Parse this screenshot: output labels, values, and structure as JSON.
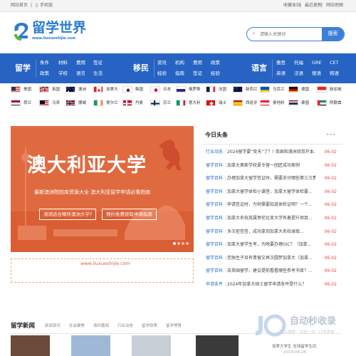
{
  "topbar": {
    "home": "网站首页",
    "mobile": "手机版",
    "favorite": "收藏本站",
    "latest": "最近更新",
    "sitemap": "网站地图"
  },
  "logo": {
    "text": "留学世界",
    "url": "www.liuxueshijie.com"
  },
  "search": {
    "placeholder": "请输入关键词",
    "button": "搜索"
  },
  "nav": {
    "study": {
      "title": "留学",
      "links": [
        "条件",
        "材料",
        "费用",
        "签证",
        "政策",
        "学校",
        "语言",
        "生活"
      ]
    },
    "immigrate": {
      "title": "移民",
      "links": [
        "资讯",
        "机构",
        "费用",
        "政策",
        "经验",
        "指南",
        "签证",
        "经验"
      ]
    },
    "language": {
      "title": "语言",
      "links": [
        "雅思",
        "托福",
        "GRE",
        "CET",
        "英语",
        "法语",
        "德语",
        "韩语"
      ]
    }
  },
  "countries": [
    {
      "name": "美国",
      "flag": "us"
    },
    {
      "name": "英国",
      "flag": "uk"
    },
    {
      "name": "澳洲",
      "flag": "au"
    },
    {
      "name": "加拿大",
      "flag": "ca"
    },
    {
      "name": "韩国",
      "flag": "kr"
    },
    {
      "name": "日本",
      "flag": "jp"
    },
    {
      "name": "俄罗斯",
      "flag": "ru"
    },
    {
      "name": "法国",
      "flag": "fr"
    },
    {
      "name": "新西兰",
      "flag": "nz"
    },
    {
      "name": "乌克兰",
      "flag": "ua"
    },
    {
      "name": "德国",
      "flag": "de"
    },
    {
      "name": "新加坡",
      "flag": "sg"
    },
    {
      "name": "荷兰",
      "flag": "nl"
    },
    {
      "name": "马来",
      "flag": "my"
    },
    {
      "name": "挪威",
      "flag": "no"
    },
    {
      "name": "爱尔兰",
      "flag": "ie"
    },
    {
      "name": "丹麦",
      "flag": "dk"
    },
    {
      "name": "芬兰",
      "flag": "fi"
    },
    {
      "name": "意大利",
      "flag": "it"
    },
    {
      "name": "瑞士",
      "flag": "ch"
    },
    {
      "name": "西班牙",
      "flag": "es"
    },
    {
      "name": "奥地利",
      "flag": "at"
    },
    {
      "name": "泰国",
      "flag": "th"
    },
    {
      "name": "阿联酋",
      "flag": "ae"
    }
  ],
  "hero": {
    "title": "澳大利亚大学",
    "subtitle": "最新澳洲院校库资源大全 澳大利亚留学申请必看指南",
    "btn1": "测测适合哪所澳洲大学?",
    "btn2": "预约免费获取申请指南"
  },
  "ad": {
    "text": "www.liuxueshijie.com"
  },
  "headlines": {
    "title": "今日头条",
    "more": "•••",
    "items": [
      {
        "cat": "行业动态",
        "text": "2024留学要“变天”了？! 英国和澳洲双双开本...",
        "date": "06-02"
      },
      {
        "cat": "留学百科",
        "text": "加拿大奥斯学校夏令营一团匠成功案例",
        "date": "06-02"
      },
      {
        "cat": "留学百科",
        "text": "办理加拿大留学签证时，需要支付哪些第三方费...",
        "date": "06-02"
      },
      {
        "cat": "留学百科",
        "text": "加拿大留学体检小课堂，加拿大留学体检要...",
        "date": "06-02"
      },
      {
        "cat": "留学百科",
        "text": "申请签证时，为何需要知道体检证明？一个...",
        "date": "06-02"
      },
      {
        "cat": "留学百科",
        "text": "加拿大名校英属哥伦比亚大学有着提升项目...",
        "date": "06-02"
      },
      {
        "cat": "留学百科",
        "text": "多次拒签签，成功拿到加拿大名校录取...",
        "date": "06-02"
      },
      {
        "cat": "留学百科",
        "text": "加拿大留学生考，为啥要办理GIC？（加拿...",
        "date": "06-02"
      },
      {
        "cat": "留学百科",
        "text": "您独生子且有青留文再次圆梦加拿大（加拿...",
        "date": "06-02"
      },
      {
        "cat": "留学百科",
        "text": "去英国留学，建议提前看看哪些参考书目？...",
        "date": "06-02"
      },
      {
        "cat": "申请条件",
        "text": "2024年加拿大硕士留学申请条件是什么？",
        "date": "06-02"
      }
    ]
  },
  "section": {
    "title": "留学新闻",
    "tabs": [
      "新闻资讯",
      "社会聚焦",
      "海外趣闻",
      "行业动态",
      "留学政策",
      "留学预警"
    ]
  },
  "watermark": {
    "brand": "自动秒收录",
    "sub": "助上线啦 · 大动一次 · 口令咨询"
  },
  "side_cards": {
    "date": "2019-06-26",
    "text": "加拿大学生 全球留学生目"
  },
  "colors": {
    "brand": "#2b7bd0",
    "nav": "#2663c2",
    "hero": "#e06a3f",
    "date": "#e44444"
  }
}
